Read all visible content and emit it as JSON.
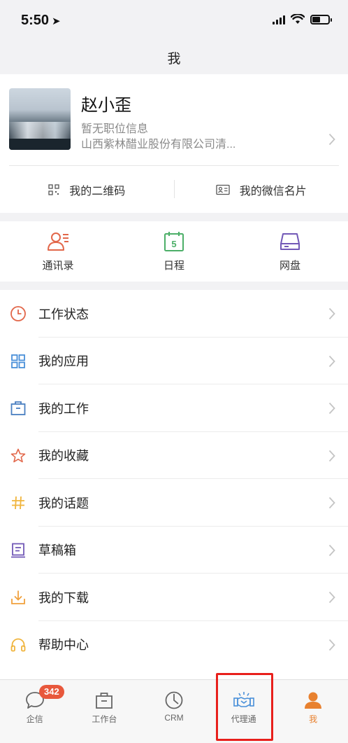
{
  "status_bar": {
    "time": "5:50"
  },
  "nav": {
    "title": "我"
  },
  "profile": {
    "name": "赵小歪",
    "position": "暂无职位信息",
    "company": "山西紫林醋业股份有限公司清..."
  },
  "profile_actions": [
    {
      "label": "我的二维码",
      "icon": "qr-code-icon"
    },
    {
      "label": "我的微信名片",
      "icon": "id-card-icon"
    }
  ],
  "shortcuts": [
    {
      "label": "通讯录",
      "icon": "contacts-icon",
      "color": "#e2674a"
    },
    {
      "label": "日程",
      "icon": "calendar-icon",
      "color": "#4caf68",
      "day": "5"
    },
    {
      "label": "网盘",
      "icon": "disk-icon",
      "color": "#7259b7"
    }
  ],
  "menu": [
    {
      "label": "工作状态",
      "icon": "clock-icon",
      "color": "#e2674a"
    },
    {
      "label": "我的应用",
      "icon": "apps-grid-icon",
      "color": "#4a90d9"
    },
    {
      "label": "我的工作",
      "icon": "briefcase-icon",
      "color": "#4a7fc1"
    },
    {
      "label": "我的收藏",
      "icon": "star-icon",
      "color": "#e2674a"
    },
    {
      "label": "我的话题",
      "icon": "hashtag-icon",
      "color": "#f0b43c"
    },
    {
      "label": "草稿箱",
      "icon": "drafts-icon",
      "color": "#7259b7"
    },
    {
      "label": "我的下载",
      "icon": "download-icon",
      "color": "#f0a03c"
    },
    {
      "label": "帮助中心",
      "icon": "headset-icon",
      "color": "#f0b43c"
    }
  ],
  "tabs": [
    {
      "label": "企信",
      "icon": "chat-bubble-icon",
      "badge": "342"
    },
    {
      "label": "工作台",
      "icon": "workbench-icon"
    },
    {
      "label": "CRM",
      "icon": "crm-clock-icon"
    },
    {
      "label": "代理通",
      "icon": "handshake-icon"
    },
    {
      "label": "我",
      "icon": "user-icon",
      "active": true
    }
  ],
  "colors": {
    "accent": "#e8812f",
    "highlight": "#e8201c",
    "blue": "#4a90d9"
  }
}
